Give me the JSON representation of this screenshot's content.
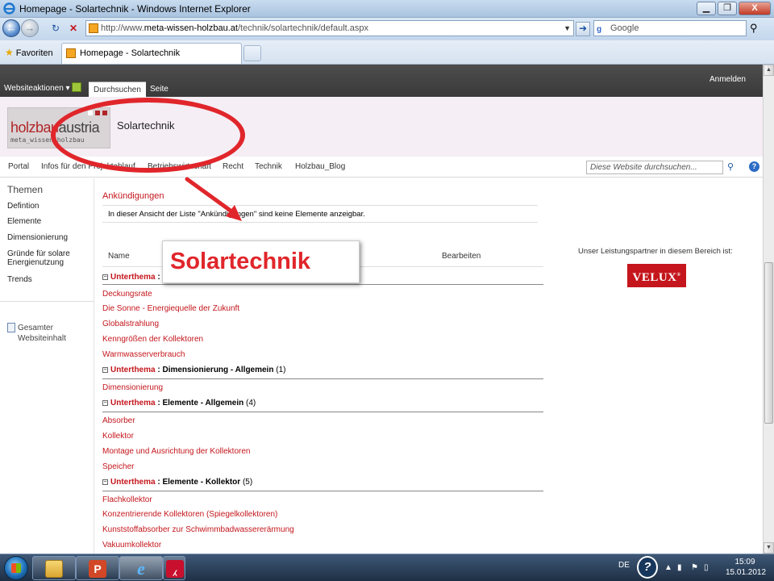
{
  "window": {
    "title": "Homepage - Solartechnik - Windows Internet Explorer",
    "buttons": {
      "minimize": "▁",
      "maximize": "❐",
      "close": "X"
    }
  },
  "addressbar": {
    "url_prefix": "http://www.",
    "url_host": "meta-wissen-holzbau.at",
    "url_path": "/technik/solartechnik/default.aspx",
    "search_placeholder": "Google"
  },
  "favbar": {
    "favorites_label": "Favoriten",
    "tab_title": "Homepage - Solartechnik"
  },
  "ribbon": {
    "site_actions": "Websiteaktionen ▾",
    "tabs": [
      "Durchsuchen",
      "Seite"
    ],
    "signin": "Anmelden"
  },
  "header": {
    "logo_brand": "holzbau",
    "logo_brand2": "austria",
    "logo_sub": "meta_wissen_holzbau",
    "site_title": "Solartechnik"
  },
  "topnav": {
    "items": [
      "Portal",
      "Infos für den Projektablauf",
      "Betriebswirtschaft",
      "Recht",
      "Technik",
      "Holzbau_Blog"
    ],
    "search_placeholder": "Diese Website durchsuchen..."
  },
  "leftnav": {
    "heading": "Themen",
    "items": [
      "Defintion",
      "Elemente",
      "Dimensionierung",
      "Gründe für solare Energienutzung",
      "Trends"
    ],
    "all_content": "Gesamter Websiteinhalt"
  },
  "announcements": {
    "title": "Ankündigungen",
    "message": "In dieser Ansicht der Liste \"Ankündigungen\" sind keine Elemente anzeigbar."
  },
  "list": {
    "col_name": "Name",
    "col_edit": "Bearbeiten",
    "groups": [
      {
        "label": "Unterthema",
        "name": "",
        "count": "",
        "items": [
          "Deckungsrate",
          "Die Sonne - Energiequelle der Zukunft",
          "Globalstrahlung",
          "Kenngrößen der Kollektoren",
          "Warmwasserverbrauch"
        ]
      },
      {
        "label": "Unterthema",
        "name": "Dimensionierung - Allgemein",
        "count": "(1)",
        "items": [
          "Dimensionierung"
        ]
      },
      {
        "label": "Unterthema",
        "name": "Elemente - Allgemein",
        "count": "(4)",
        "items": [
          "Absorber",
          "Kollektor",
          "Montage und Ausrichtung der Kollektoren",
          "Speicher"
        ]
      },
      {
        "label": "Unterthema",
        "name": "Elemente - Kollektor",
        "count": "(5)",
        "items": [
          "Flachkollektor",
          "Konzentrierende Kollektoren (Spiegelkollektoren)",
          "Kunststoffabsorber zur Schwimmbadwassererärmung",
          "Vakuumkollektor"
        ]
      }
    ]
  },
  "partner": {
    "text": "Unser Leistungspartner in diesem Bereich ist:",
    "logo": "VELUX",
    "logo_mark": "®"
  },
  "callout": {
    "text": "Solartechnik"
  },
  "taskbar": {
    "lang": "DE",
    "time": "15:09",
    "date": "15.01.2012"
  },
  "colors": {
    "accent": "#c4161c",
    "annotation": "#e0262b",
    "ribbon": "#3a3a3a"
  },
  "icons": [
    "ie-icon",
    "back-icon",
    "forward-icon",
    "refresh-icon",
    "stop-icon",
    "go-icon",
    "search-icon",
    "favorites-star-icon",
    "edit-page-icon",
    "help-icon",
    "document-icon",
    "expand-toggle-icon",
    "start-orb-icon",
    "explorer-icon",
    "powerpoint-icon",
    "internet-explorer-icon",
    "pdf-icon"
  ]
}
